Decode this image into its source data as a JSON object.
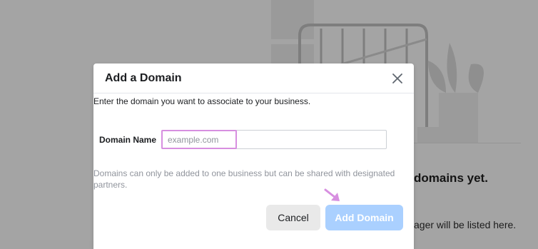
{
  "background": {
    "heading": "domains yet.",
    "subtext": "ager will be listed here."
  },
  "modal": {
    "title": "Add a Domain",
    "close_icon": "close-icon",
    "description": "Enter the domain you want to associate to your business.",
    "domain_field": {
      "label": "Domain Name",
      "placeholder": "example.com",
      "value": ""
    },
    "help_text": "Domains can only be added to one business but can be shared with designated partners.",
    "cancel_label": "Cancel",
    "add_label": "Add Domain"
  },
  "annotations": {
    "highlight_color": "#d78fe0",
    "arrow_icon": "pointer-arrow-icon"
  },
  "colors": {
    "overlay": "#a4a4a4",
    "add_button_disabled": "#aad0ff",
    "cancel_button": "#e9e9e9"
  }
}
